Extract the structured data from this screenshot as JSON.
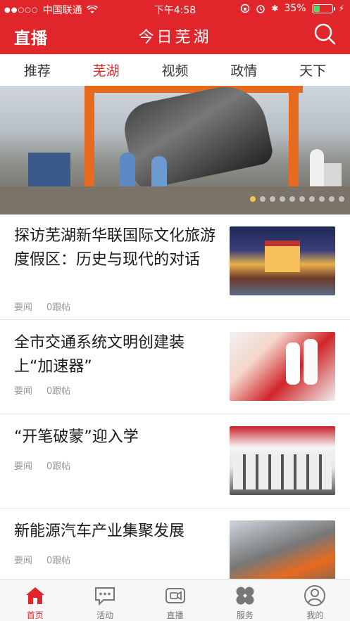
{
  "status_bar": {
    "signal_dots": "●●○○○",
    "carrier": "中国联通",
    "time": "下午4:58",
    "battery_percent": "35%",
    "battery_level": 0.35
  },
  "header": {
    "left_button": "直播",
    "title": "今日芜湖"
  },
  "tabs": [
    "推荐",
    "芜湖",
    "视频",
    "政情",
    "天下"
  ],
  "active_tab_index": 1,
  "banner": {
    "slide_count": 10,
    "active_index": 0
  },
  "articles": [
    {
      "title": "探访芜湖新华联国际文化旅游度假区：历史与现代的对话",
      "category": "要闻",
      "comments": "0跟帖"
    },
    {
      "title": "全市交通系统文明创建装上“加速器”",
      "category": "要闻",
      "comments": "0跟帖"
    },
    {
      "title": "“开笔破蒙”迎入学",
      "category": "要闻",
      "comments": "0跟帖"
    },
    {
      "title": "新能源汽车产业集聚发展",
      "category": "要闻",
      "comments": "0跟帖"
    }
  ],
  "bottom_nav": [
    "首页",
    "活动",
    "直播",
    "服务",
    "我的"
  ],
  "active_nav_index": 0,
  "colors": {
    "brand_red": "#e0262a",
    "battery_green": "#4cd964"
  }
}
